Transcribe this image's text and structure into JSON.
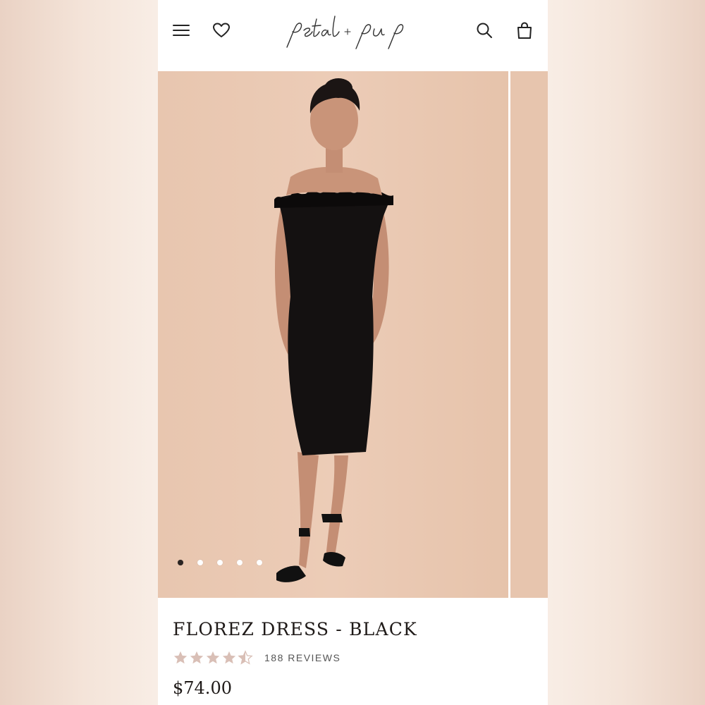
{
  "header": {
    "brand": "petal + pup",
    "icons": {
      "menu": "hamburger-menu-icon",
      "wishlist": "heart-icon",
      "search": "search-icon",
      "cart": "shopping-bag-icon"
    }
  },
  "gallery": {
    "slide_count": 5,
    "active_index": 0
  },
  "product": {
    "title": "FLOREZ DRESS - BLACK",
    "rating": 4.5,
    "reviews_label": "188 REVIEWS",
    "price": "$74.00"
  },
  "colors": {
    "background_fill": "#e9c8b2",
    "star_color": "#d9bfb6",
    "text": "#1f1a18"
  }
}
